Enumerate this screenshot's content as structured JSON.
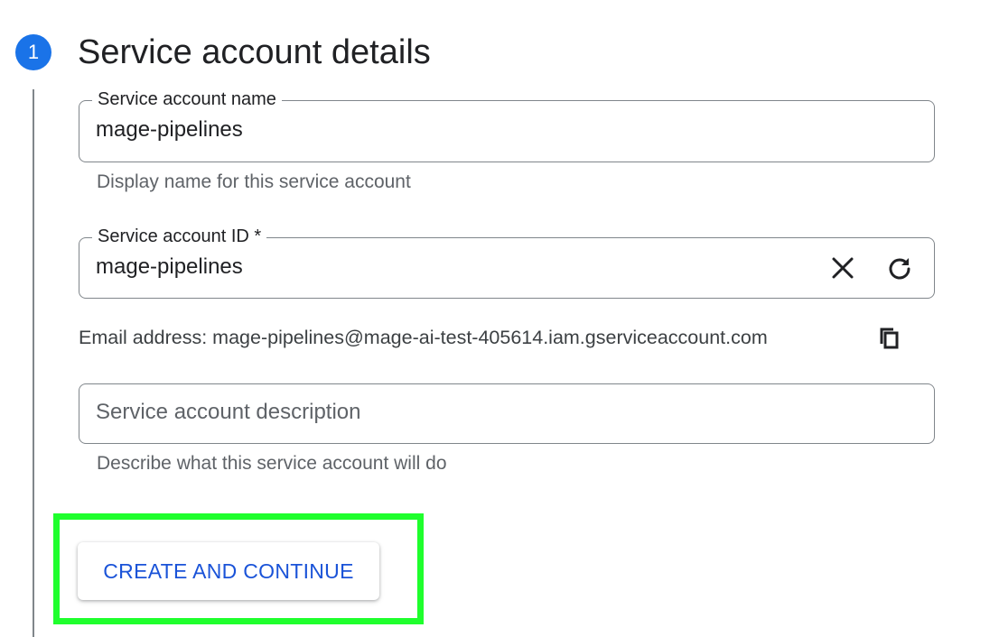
{
  "step": {
    "number": "1",
    "title": "Service account details"
  },
  "name_field": {
    "label": "Service account name",
    "value": "mage-pipelines",
    "hint": "Display name for this service account"
  },
  "id_field": {
    "label": "Service account ID *",
    "value": "mage-pipelines",
    "clear_icon": "close-icon",
    "refresh_icon": "refresh-icon"
  },
  "email": {
    "text": "Email address: mage-pipelines@mage-ai-test-405614.iam.gserviceaccount.com",
    "copy_icon": "copy-icon"
  },
  "description_field": {
    "placeholder": "Service account description",
    "hint": "Describe what this service account will do"
  },
  "actions": {
    "create_label": "CREATE AND CONTINUE"
  },
  "colors": {
    "accent": "#1a73e8",
    "button_text": "#1a53d8",
    "highlight": "#1fff2d"
  }
}
